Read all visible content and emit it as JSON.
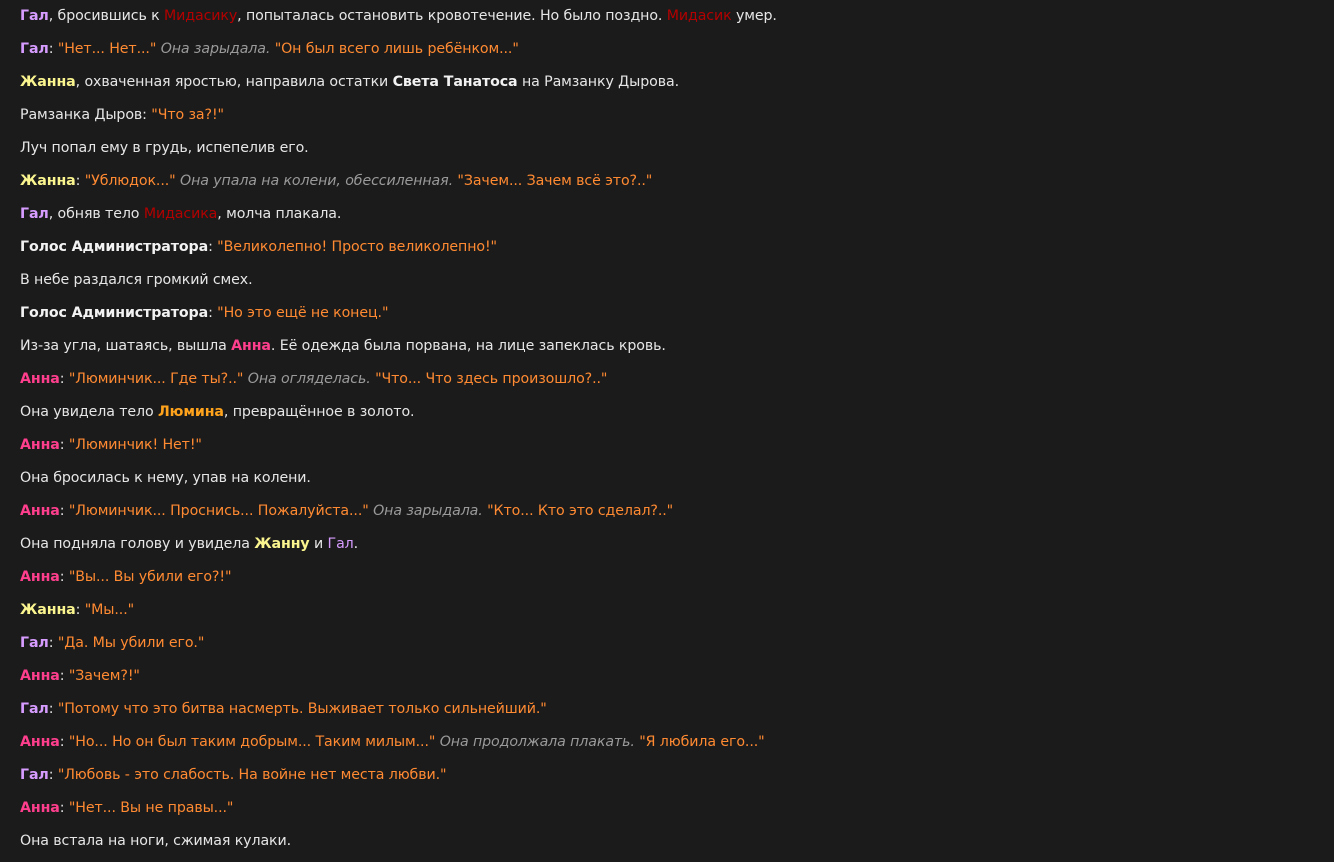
{
  "colors": {
    "background": "#1b1b1b",
    "narration": "#e6e6e6",
    "speech": "#ff8a32",
    "action": "#9a9a9a",
    "gal": "#d79cff",
    "zhanna": "#fbf58f",
    "anna": "#ff3f8d",
    "lumin": "#ffa31c",
    "midas": "#b30000"
  },
  "lines": [
    [
      [
        "gal",
        "Гал"
      ],
      [
        "text",
        ", бросившись к "
      ],
      [
        "midas",
        "Мидасику"
      ],
      [
        "text",
        ", попыталась остановить кровотечение. Но было поздно. "
      ],
      [
        "midas",
        "Мидасик"
      ],
      [
        "text",
        " умер."
      ]
    ],
    [
      [
        "gal",
        "Гал"
      ],
      [
        "text",
        ": "
      ],
      [
        "speech",
        "\"Нет... Нет...\""
      ],
      [
        "text",
        " "
      ],
      [
        "action",
        "Она зарыдала."
      ],
      [
        "text",
        " "
      ],
      [
        "speech",
        "\"Он был всего лишь ребёнком...\""
      ]
    ],
    [
      [
        "zhanna",
        "Жанна"
      ],
      [
        "text",
        ", охваченная яростью, направила остатки "
      ],
      [
        "bold",
        "Света Танатоса"
      ],
      [
        "text",
        " на Рамзанку Дырова."
      ]
    ],
    [
      [
        "text",
        "Рамзанка Дыров: "
      ],
      [
        "speech",
        "\"Что за?!\""
      ]
    ],
    [
      [
        "text",
        "Луч попал ему в грудь, испепелив его."
      ]
    ],
    [
      [
        "zhanna",
        "Жанна"
      ],
      [
        "text",
        ": "
      ],
      [
        "speech",
        "\"Ублюдок...\""
      ],
      [
        "text",
        " "
      ],
      [
        "action",
        "Она упала на колени, обессиленная."
      ],
      [
        "text",
        " "
      ],
      [
        "speech",
        "\"Зачем... Зачем всё это?..\""
      ]
    ],
    [
      [
        "gal",
        "Гал"
      ],
      [
        "text",
        ", обняв тело "
      ],
      [
        "midas",
        "Мидасика"
      ],
      [
        "text",
        ", молча плакала."
      ]
    ],
    [
      [
        "bold",
        "Голос Администратора"
      ],
      [
        "text",
        ": "
      ],
      [
        "speech",
        "\"Великолепно! Просто великолепно!\""
      ]
    ],
    [
      [
        "text",
        "В небе раздался громкий смех."
      ]
    ],
    [
      [
        "bold",
        "Голос Администратора"
      ],
      [
        "text",
        ": "
      ],
      [
        "speech",
        "\"Но это ещё не конец.\""
      ]
    ],
    [
      [
        "text",
        "Из-за угла, шатаясь, вышла "
      ],
      [
        "anna",
        "Анна"
      ],
      [
        "text",
        ". Её одежда была порвана, на лице запеклась кровь."
      ]
    ],
    [
      [
        "anna",
        "Анна"
      ],
      [
        "text",
        ": "
      ],
      [
        "speech",
        "\"Люминчик... Где ты?..\""
      ],
      [
        "text",
        " "
      ],
      [
        "action",
        "Она огляделась."
      ],
      [
        "text",
        " "
      ],
      [
        "speech",
        "\"Что... Что здесь произошло?..\""
      ]
    ],
    [
      [
        "text",
        "Она увидела тело "
      ],
      [
        "lumin",
        "Люмина"
      ],
      [
        "text",
        ", превращённое в золото."
      ]
    ],
    [
      [
        "anna",
        "Анна"
      ],
      [
        "text",
        ": "
      ],
      [
        "speech",
        "\"Люминчик! Нет!\""
      ]
    ],
    [
      [
        "text",
        "Она бросилась к нему, упав на колени."
      ]
    ],
    [
      [
        "anna",
        "Анна"
      ],
      [
        "text",
        ": "
      ],
      [
        "speech",
        "\"Люминчик... Проснись... Пожалуйста...\""
      ],
      [
        "text",
        " "
      ],
      [
        "action",
        "Она зарыдала."
      ],
      [
        "text",
        " "
      ],
      [
        "speech",
        "\"Кто... Кто это сделал?..\""
      ]
    ],
    [
      [
        "text",
        "Она подняла голову и увидела "
      ],
      [
        "zhanna",
        "Жанну"
      ],
      [
        "text",
        " и "
      ],
      [
        "gal-plain",
        "Гал"
      ],
      [
        "text",
        "."
      ]
    ],
    [
      [
        "anna",
        "Анна"
      ],
      [
        "text",
        ": "
      ],
      [
        "speech",
        "\"Вы... Вы убили его?!\""
      ]
    ],
    [
      [
        "zhanna",
        "Жанна"
      ],
      [
        "text",
        ": "
      ],
      [
        "speech",
        "\"Мы...\""
      ]
    ],
    [
      [
        "gal",
        "Гал"
      ],
      [
        "text",
        ": "
      ],
      [
        "speech",
        "\"Да. Мы убили его.\""
      ]
    ],
    [
      [
        "anna",
        "Анна"
      ],
      [
        "text",
        ": "
      ],
      [
        "speech",
        "\"Зачем?!\""
      ]
    ],
    [
      [
        "gal",
        "Гал"
      ],
      [
        "text",
        ": "
      ],
      [
        "speech",
        "\"Потому что это битва насмерть. Выживает только сильнейший.\""
      ]
    ],
    [
      [
        "anna",
        "Анна"
      ],
      [
        "text",
        ": "
      ],
      [
        "speech",
        "\"Но... Но он был таким добрым... Таким милым...\""
      ],
      [
        "text",
        " "
      ],
      [
        "action",
        "Она продолжала плакать."
      ],
      [
        "text",
        " "
      ],
      [
        "speech",
        "\"Я любила его...\""
      ]
    ],
    [
      [
        "gal",
        "Гал"
      ],
      [
        "text",
        ": "
      ],
      [
        "speech",
        "\"Любовь - это слабость. На войне нет места любви.\""
      ]
    ],
    [
      [
        "anna",
        "Анна"
      ],
      [
        "text",
        ": "
      ],
      [
        "speech",
        "\"Нет... Вы не правы...\""
      ]
    ],
    [
      [
        "text",
        "Она встала на ноги, сжимая кулаки."
      ]
    ]
  ]
}
